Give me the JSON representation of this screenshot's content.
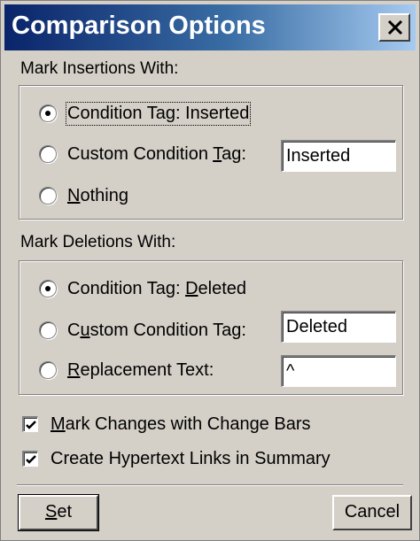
{
  "window": {
    "title": "Comparison Options",
    "close_icon": "close-x-icon"
  },
  "insertions": {
    "label": "Mark Insertions With:",
    "options": [
      {
        "label": "Condition Tag: Inserted",
        "selected": true
      },
      {
        "label_pre": "Custom Condition ",
        "label_u": "T",
        "label_post": "ag:",
        "selected": false
      },
      {
        "label_u": "N",
        "label_post": "othing",
        "selected": false
      }
    ],
    "custom_tag_value": "Inserted"
  },
  "deletions": {
    "label": "Mark Deletions With:",
    "options": [
      {
        "label_pre": "Condition Tag: ",
        "label_u": "D",
        "label_post": "eleted",
        "selected": true
      },
      {
        "label_pre": "C",
        "label_u": "u",
        "label_post": "stom Condition Tag:",
        "selected": false
      },
      {
        "label_u": "R",
        "label_post": "eplacement Text:",
        "selected": false
      }
    ],
    "custom_tag_value": "Deleted",
    "replacement_text_value": "^"
  },
  "options": {
    "change_bars": {
      "label_u": "M",
      "label_post": "ark Changes with Change Bars",
      "checked": true
    },
    "hypertext": {
      "label": "Create Hypertext Links in Summary",
      "checked": true
    }
  },
  "buttons": {
    "set": {
      "label_u": "S",
      "label_post": "et"
    },
    "cancel": {
      "label": "Cancel"
    }
  }
}
